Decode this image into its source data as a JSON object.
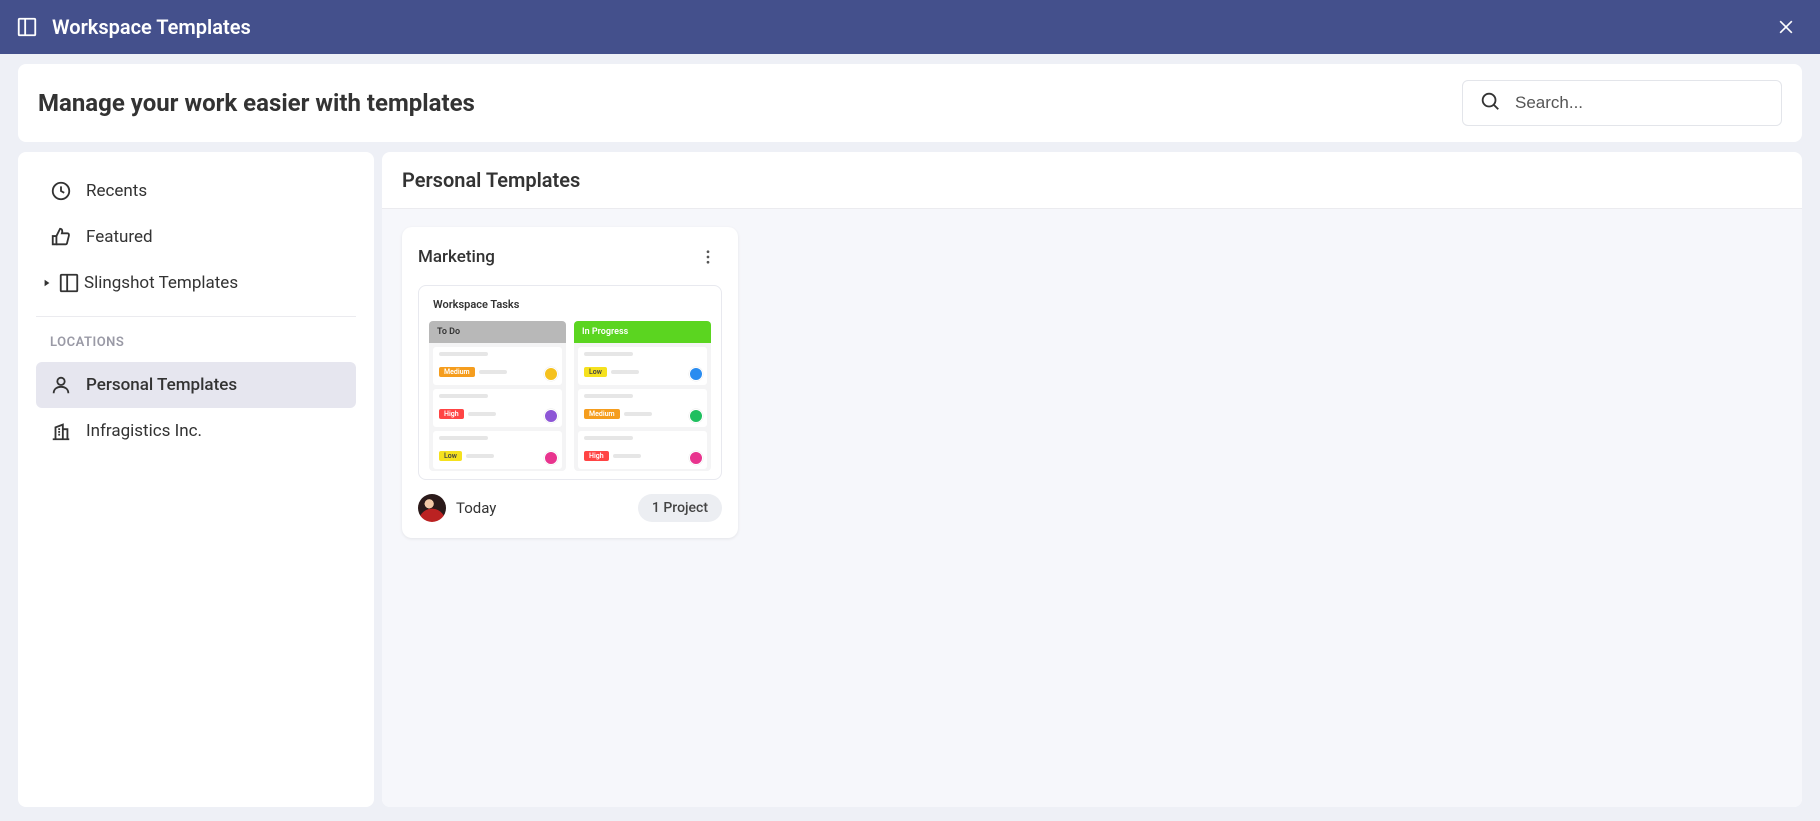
{
  "titlebar": {
    "title": "Workspace Templates"
  },
  "header": {
    "heading": "Manage your work easier with templates",
    "search_placeholder": "Search..."
  },
  "sidebar": {
    "recents": "Recents",
    "featured": "Featured",
    "slingshot": "Slingshot Templates",
    "locations_label": "LOCATIONS",
    "personal": "Personal Templates",
    "infragistics": "Infragistics Inc."
  },
  "main": {
    "section_title": "Personal Templates"
  },
  "card": {
    "title": "Marketing",
    "preview_title": "Workspace Tasks",
    "col_todo": "To Do",
    "col_inprogress": "In Progress",
    "tags": {
      "medium": "Medium",
      "high": "High",
      "low": "Low"
    },
    "date": "Today",
    "project_badge": "1 Project"
  },
  "colors": {
    "primary": "#44508c",
    "accent_green": "#5bd520",
    "tag_medium": "#f59d1e",
    "tag_high": "#f44",
    "tag_low": "#f5e11e"
  }
}
